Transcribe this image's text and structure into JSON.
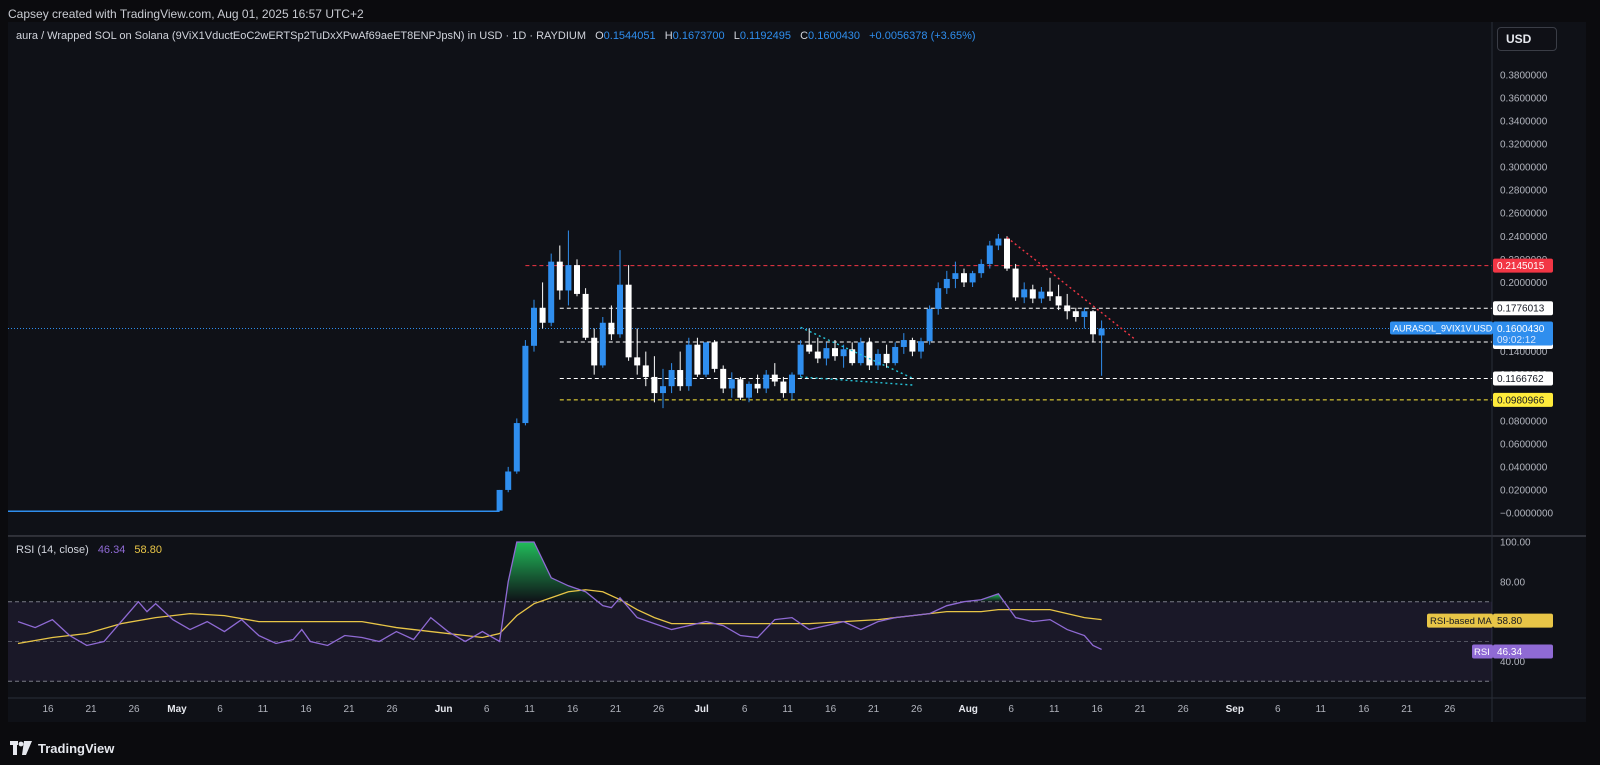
{
  "header": {
    "credit": "Capsey created with TradingView.com, Aug 01, 2025 16:57 UTC+2",
    "symbol": "aura / Wrapped SOL on Solana (9ViX1VductEoC2wERTSp2TuDxXPwAf69aeET8ENPJpsN) in USD · 1D · RAYDIUM",
    "o_label": "O",
    "o_value": "0.1544051",
    "h_label": "H",
    "h_value": "0.1673700",
    "l_label": "L",
    "l_value": "0.1192495",
    "c_label": "C",
    "c_value": "0.1600430",
    "change": "+0.0056378 (+3.65%)",
    "currency_button": "USD"
  },
  "footer": {
    "brand": "TradingView"
  },
  "colors": {
    "bg": "#0f1117",
    "up": "#2f8eee",
    "down": "#ffffff",
    "rsi": "#8f6ad4",
    "ma": "#e8c547",
    "red_line": "#f23645",
    "yellow_line": "#ffeb3b"
  },
  "rsi_legend": {
    "name": "RSI (14, close)",
    "rsi": "46.34",
    "ma": "58.80"
  },
  "chart_data": [
    {
      "type": "candlestick",
      "title": "aura / Wrapped SOL on Solana in USD · 1D · RAYDIUM",
      "ylim": [
        -0.012,
        0.39
      ],
      "y_ticks": [
        "0.3800000",
        "0.3600000",
        "0.3400000",
        "0.3200000",
        "0.3000000",
        "0.2800000",
        "0.2600000",
        "0.2400000",
        "0.2200000",
        "0.2000000",
        "0.1800000",
        "0.1600000",
        "0.1400000",
        "0.1200000",
        "0.1000000",
        "0.0800000",
        "0.0600000",
        "0.0400000",
        "0.0200000",
        "−0.0000000"
      ],
      "y_tick_values": [
        0.38,
        0.36,
        0.34,
        0.32,
        0.3,
        0.28,
        0.26,
        0.24,
        0.22,
        0.2,
        0.18,
        0.16,
        0.14,
        0.12,
        0.1,
        0.08,
        0.06,
        0.04,
        0.02,
        0.0
      ],
      "x_ticks": [
        "16",
        "21",
        "26",
        "May",
        "6",
        "11",
        "16",
        "21",
        "26",
        "Jun",
        "6",
        "11",
        "16",
        "21",
        "26",
        "Jul",
        "6",
        "11",
        "16",
        "21",
        "26",
        "Aug",
        "6",
        "11",
        "16",
        "21",
        "26",
        "Sep",
        "6",
        "11",
        "16",
        "21",
        "26"
      ],
      "x_tick_days": [
        0,
        5,
        10,
        15,
        20,
        25,
        30,
        35,
        40,
        46,
        51,
        56,
        61,
        66,
        71,
        76,
        81,
        86,
        91,
        96,
        101,
        107,
        112,
        117,
        122,
        127,
        132,
        138,
        143,
        148,
        153,
        158,
        163
      ],
      "start_date": "2025-04-16",
      "flat_until_day": 56,
      "ohlc": [
        [
          56,
          0.002,
          0.02,
          0.002,
          0.02
        ],
        [
          57,
          0.02,
          0.04,
          0.018,
          0.036
        ],
        [
          58,
          0.036,
          0.082,
          0.034,
          0.078
        ],
        [
          59,
          0.078,
          0.15,
          0.076,
          0.145
        ],
        [
          60,
          0.145,
          0.185,
          0.14,
          0.178
        ],
        [
          61,
          0.178,
          0.2,
          0.16,
          0.165
        ],
        [
          62,
          0.165,
          0.225,
          0.162,
          0.218
        ],
        [
          63,
          0.218,
          0.232,
          0.185,
          0.193
        ],
        [
          64,
          0.193,
          0.245,
          0.18,
          0.215
        ],
        [
          65,
          0.215,
          0.22,
          0.188,
          0.19
        ],
        [
          66,
          0.19,
          0.195,
          0.15,
          0.152
        ],
        [
          67,
          0.152,
          0.16,
          0.12,
          0.128
        ],
        [
          68,
          0.128,
          0.17,
          0.126,
          0.165
        ],
        [
          69,
          0.165,
          0.18,
          0.15,
          0.155
        ],
        [
          70,
          0.155,
          0.228,
          0.152,
          0.198
        ],
        [
          71,
          0.198,
          0.215,
          0.132,
          0.135
        ],
        [
          72,
          0.135,
          0.16,
          0.12,
          0.128
        ],
        [
          73,
          0.128,
          0.14,
          0.11,
          0.118
        ],
        [
          74,
          0.118,
          0.136,
          0.096,
          0.104
        ],
        [
          75,
          0.104,
          0.125,
          0.091,
          0.11
        ],
        [
          76,
          0.11,
          0.13,
          0.104,
          0.124
        ],
        [
          77,
          0.124,
          0.14,
          0.106,
          0.11
        ],
        [
          78,
          0.11,
          0.152,
          0.106,
          0.146
        ],
        [
          79,
          0.146,
          0.152,
          0.118,
          0.12
        ],
        [
          80,
          0.12,
          0.148,
          0.118,
          0.148
        ],
        [
          81,
          0.148,
          0.15,
          0.122,
          0.125
        ],
        [
          82,
          0.125,
          0.128,
          0.104,
          0.108
        ],
        [
          83,
          0.108,
          0.122,
          0.1,
          0.116
        ],
        [
          84,
          0.116,
          0.118,
          0.098,
          0.1
        ],
        [
          85,
          0.1,
          0.114,
          0.096,
          0.112
        ],
        [
          86,
          0.112,
          0.12,
          0.104,
          0.108
        ],
        [
          87,
          0.108,
          0.124,
          0.104,
          0.12
        ],
        [
          88,
          0.12,
          0.13,
          0.11,
          0.114
        ],
        [
          89,
          0.114,
          0.118,
          0.1,
          0.104
        ],
        [
          90,
          0.104,
          0.122,
          0.098,
          0.12
        ],
        [
          91,
          0.12,
          0.15,
          0.118,
          0.146
        ],
        [
          92,
          0.146,
          0.16,
          0.138,
          0.14
        ],
        [
          93,
          0.14,
          0.152,
          0.13,
          0.134
        ],
        [
          94,
          0.134,
          0.148,
          0.128,
          0.143
        ],
        [
          95,
          0.143,
          0.15,
          0.132,
          0.136
        ],
        [
          96,
          0.136,
          0.146,
          0.126,
          0.142
        ],
        [
          97,
          0.142,
          0.148,
          0.128,
          0.13
        ],
        [
          98,
          0.13,
          0.152,
          0.128,
          0.148
        ],
        [
          99,
          0.148,
          0.152,
          0.124,
          0.128
        ],
        [
          100,
          0.128,
          0.142,
          0.124,
          0.138
        ],
        [
          101,
          0.138,
          0.146,
          0.126,
          0.13
        ],
        [
          102,
          0.13,
          0.148,
          0.128,
          0.144
        ],
        [
          103,
          0.144,
          0.156,
          0.138,
          0.15
        ],
        [
          104,
          0.15,
          0.152,
          0.136,
          0.14
        ],
        [
          105,
          0.14,
          0.152,
          0.134,
          0.149
        ],
        [
          106,
          0.149,
          0.18,
          0.146,
          0.177
        ],
        [
          107,
          0.177,
          0.2,
          0.172,
          0.195
        ],
        [
          108,
          0.195,
          0.21,
          0.19,
          0.203
        ],
        [
          109,
          0.203,
          0.218,
          0.195,
          0.208
        ],
        [
          110,
          0.208,
          0.212,
          0.196,
          0.2
        ],
        [
          111,
          0.2,
          0.21,
          0.196,
          0.208
        ],
        [
          112,
          0.208,
          0.22,
          0.204,
          0.216
        ],
        [
          113,
          0.216,
          0.236,
          0.212,
          0.232
        ],
        [
          114,
          0.232,
          0.242,
          0.228,
          0.238
        ],
        [
          115,
          0.238,
          0.24,
          0.21,
          0.212
        ],
        [
          116,
          0.212,
          0.216,
          0.184,
          0.187
        ],
        [
          117,
          0.187,
          0.2,
          0.182,
          0.194
        ],
        [
          118,
          0.194,
          0.198,
          0.182,
          0.186
        ],
        [
          119,
          0.186,
          0.196,
          0.182,
          0.192
        ],
        [
          120,
          0.192,
          0.204,
          0.184,
          0.188
        ],
        [
          121,
          0.188,
          0.198,
          0.176,
          0.18
        ],
        [
          122,
          0.18,
          0.19,
          0.168,
          0.175
        ],
        [
          123,
          0.175,
          0.178,
          0.166,
          0.17
        ],
        [
          124,
          0.17,
          0.178,
          0.16,
          0.175
        ],
        [
          125,
          0.175,
          0.176,
          0.148,
          0.155
        ],
        [
          126,
          0.154,
          0.167,
          0.119,
          0.16
        ]
      ],
      "levels": [
        {
          "label": "0.2145015",
          "value": 0.2145015,
          "color": "#f23645"
        },
        {
          "label": "0.1776013",
          "value": 0.1776013,
          "color": "#ffffff"
        },
        {
          "label": "0.1482594",
          "value": 0.1482594,
          "color": "#ffffff"
        },
        {
          "label": "0.1166762",
          "value": 0.1166762,
          "color": "#ffffff"
        },
        {
          "label": "0.0980966",
          "value": 0.0980966,
          "color": "#ffeb3b"
        }
      ],
      "price_tag": {
        "symbol": "AURASOL_9VIX1V.USD",
        "price": "0.1600430",
        "countdown": "09:02:12",
        "value": 0.160043
      },
      "annotations": [
        {
          "kind": "trend",
          "color": "#26c6da",
          "points": [
            [
              91,
              0.161
            ],
            [
              104,
              0.117
            ]
          ]
        },
        {
          "kind": "trend",
          "color": "#26c6da",
          "points": [
            [
              91,
              0.118
            ],
            [
              104,
              0.111
            ]
          ]
        },
        {
          "kind": "trend",
          "color": "#f23645",
          "points": [
            [
              115,
              0.239
            ],
            [
              130,
              0.15
            ]
          ]
        }
      ]
    },
    {
      "type": "line",
      "title": "RSI (14, close)",
      "ylim": [
        20,
        100
      ],
      "y_ticks": [
        "100.00",
        "80.00",
        "40.00"
      ],
      "y_tick_values": [
        100,
        80,
        40
      ],
      "bands": [
        70,
        50,
        30
      ],
      "series": [
        {
          "name": "RSI",
          "value_label": "46.34",
          "color": "#8f6ad4",
          "values": [
            [
              0,
              60
            ],
            [
              2,
              57
            ],
            [
              4,
              61
            ],
            [
              6,
              53
            ],
            [
              8,
              48
            ],
            [
              10,
              50
            ],
            [
              12,
              60
            ],
            [
              14,
              70
            ],
            [
              15,
              65
            ],
            [
              16,
              69
            ],
            [
              18,
              61
            ],
            [
              20,
              56
            ],
            [
              22,
              60
            ],
            [
              24,
              55
            ],
            [
              26,
              61
            ],
            [
              28,
              53
            ],
            [
              30,
              49
            ],
            [
              32,
              51
            ],
            [
              33,
              56
            ],
            [
              34,
              50
            ],
            [
              36,
              48
            ],
            [
              38,
              53
            ],
            [
              40,
              52
            ],
            [
              42,
              50
            ],
            [
              44,
              55
            ],
            [
              46,
              51
            ],
            [
              48,
              62
            ],
            [
              50,
              55
            ],
            [
              52,
              50
            ],
            [
              54,
              55
            ],
            [
              56,
              50
            ],
            [
              57,
              80
            ],
            [
              58,
              100
            ],
            [
              60,
              100
            ],
            [
              62,
              82
            ],
            [
              64,
              78
            ],
            [
              66,
              75
            ],
            [
              68,
              68
            ],
            [
              69,
              67
            ],
            [
              70,
              72
            ],
            [
              72,
              62
            ],
            [
              74,
              59
            ],
            [
              76,
              56
            ],
            [
              78,
              58
            ],
            [
              80,
              60
            ],
            [
              82,
              58
            ],
            [
              84,
              53
            ],
            [
              86,
              52
            ],
            [
              88,
              61
            ],
            [
              90,
              62
            ],
            [
              92,
              56
            ],
            [
              94,
              58
            ],
            [
              96,
              60
            ],
            [
              98,
              56
            ],
            [
              100,
              60
            ],
            [
              102,
              62
            ],
            [
              104,
              63
            ],
            [
              106,
              64
            ],
            [
              108,
              68
            ],
            [
              110,
              70
            ],
            [
              112,
              71
            ],
            [
              114,
              74
            ],
            [
              116,
              62
            ],
            [
              118,
              60
            ],
            [
              120,
              61
            ],
            [
              122,
              56
            ],
            [
              124,
              53
            ],
            [
              125,
              48
            ],
            [
              126,
              46
            ]
          ]
        },
        {
          "name": "RSI-based MA",
          "value_label": "58.80",
          "color": "#e8c547",
          "values": [
            [
              0,
              49
            ],
            [
              4,
              52
            ],
            [
              8,
              54
            ],
            [
              12,
              59
            ],
            [
              16,
              62
            ],
            [
              20,
              64
            ],
            [
              24,
              63
            ],
            [
              28,
              60
            ],
            [
              32,
              60
            ],
            [
              36,
              60
            ],
            [
              40,
              60
            ],
            [
              44,
              57
            ],
            [
              48,
              55
            ],
            [
              52,
              53
            ],
            [
              54,
              52
            ],
            [
              56,
              54
            ],
            [
              58,
              63
            ],
            [
              60,
              69
            ],
            [
              62,
              72
            ],
            [
              64,
              75
            ],
            [
              66,
              76
            ],
            [
              68,
              75
            ],
            [
              70,
              71
            ],
            [
              72,
              66
            ],
            [
              74,
              62
            ],
            [
              76,
              59
            ],
            [
              80,
              59
            ],
            [
              84,
              59
            ],
            [
              88,
              59
            ],
            [
              92,
              59
            ],
            [
              96,
              60
            ],
            [
              100,
              61
            ],
            [
              104,
              63
            ],
            [
              108,
              65
            ],
            [
              110,
              65
            ],
            [
              112,
              65
            ],
            [
              114,
              66
            ],
            [
              116,
              66
            ],
            [
              118,
              66
            ],
            [
              120,
              66
            ],
            [
              122,
              64
            ],
            [
              124,
              62
            ],
            [
              126,
              61
            ]
          ]
        }
      ]
    }
  ]
}
